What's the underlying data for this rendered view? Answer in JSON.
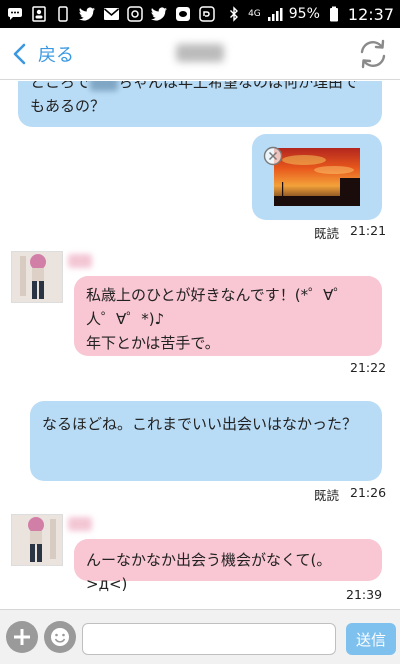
{
  "status_bar": {
    "icons": [
      "message-icon",
      "contacts-icon",
      "phone-icon",
      "twitter-icon",
      "mail-icon",
      "chat-app-icon",
      "twitter-icon",
      "chat-app-icon",
      "chat-app-icon"
    ],
    "bluetooth": "bluetooth-icon",
    "network": "4G",
    "battery": "95%",
    "time": "12:37"
  },
  "nav": {
    "back_label": "戻る",
    "refresh_icon": "refresh-icon"
  },
  "messages": [
    {
      "side": "right",
      "text_pre": "ところで",
      "text_post": "ちゃんは年上希望なのは何か理由でもあるの？"
    },
    {
      "side": "right",
      "type": "image",
      "read": "既読",
      "time": "21:21"
    },
    {
      "side": "left",
      "line1": "私歳上のひとが好きなんです！(*゜∀゜",
      "line2": "人゜∀゜*)♪",
      "line3": "年下とかは苦手で。",
      "time": "21:22"
    },
    {
      "side": "right",
      "text": "なるほどね。これまでいい出会いはなかった？",
      "read": "既読",
      "time": "21:26"
    },
    {
      "side": "left",
      "text": "んーなかなか出会う機会がなくて(。>д<)",
      "time": "21:39"
    }
  ],
  "input": {
    "placeholder": "",
    "send_label": "送信"
  },
  "colors": {
    "accent": "#3a98e0",
    "bubble_blue": "#b9dcf6",
    "bubble_pink": "#f9c6d3"
  }
}
